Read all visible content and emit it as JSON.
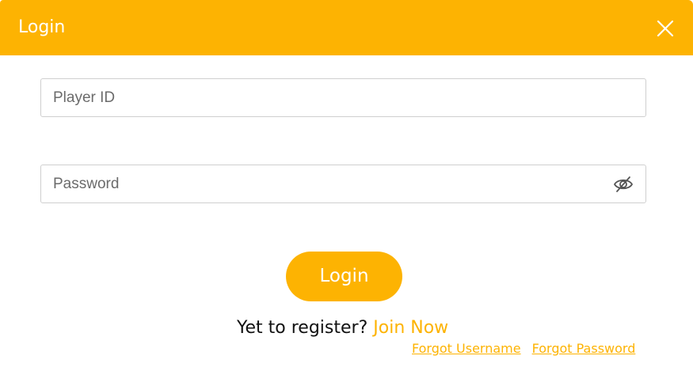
{
  "header": {
    "title": "Login",
    "close_icon": "close-icon"
  },
  "form": {
    "player_id": {
      "placeholder": "Player ID",
      "value": ""
    },
    "password": {
      "placeholder": "Password",
      "value": "",
      "toggle_icon": "eye-slash-icon"
    },
    "login_label": "Login"
  },
  "register": {
    "prompt": "Yet to register? ",
    "join_label": "Join Now"
  },
  "links": {
    "forgot_username": "Forgot Username",
    "forgot_password": "Forgot Password"
  },
  "colors": {
    "accent": "#fdb302",
    "text": "#111111",
    "placeholder": "#6b6b6b",
    "border": "#cfcfcf"
  }
}
